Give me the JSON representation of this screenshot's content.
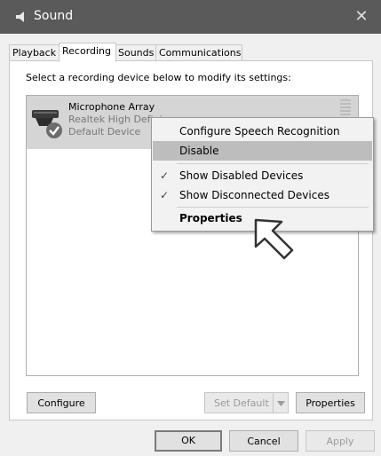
{
  "window": {
    "title": "Sound",
    "close": "✕"
  },
  "tabs": [
    "Playback",
    "Recording",
    "Sounds",
    "Communications"
  ],
  "panel": {
    "instruction": "Select a recording device below to modify its settings:"
  },
  "device": {
    "name": "Microphone Array",
    "driver": "Realtek High Defini",
    "status": "Default Device"
  },
  "context_menu": {
    "items": [
      {
        "label": "Configure Speech Recognition",
        "checked": false,
        "bold": false
      },
      {
        "label": "Disable",
        "checked": false,
        "bold": false,
        "highlighted": true
      },
      {
        "label": "Show Disabled Devices",
        "checked": true,
        "bold": false
      },
      {
        "label": "Show Disconnected Devices",
        "checked": true,
        "bold": false
      },
      {
        "label": "Properties",
        "checked": false,
        "bold": true
      }
    ],
    "check_glyph": "✓"
  },
  "panel_buttons": {
    "configure": "Configure",
    "set_default": "Set Default",
    "properties": "Properties"
  },
  "dialog_buttons": {
    "ok": "OK",
    "cancel": "Cancel",
    "apply": "Apply"
  }
}
